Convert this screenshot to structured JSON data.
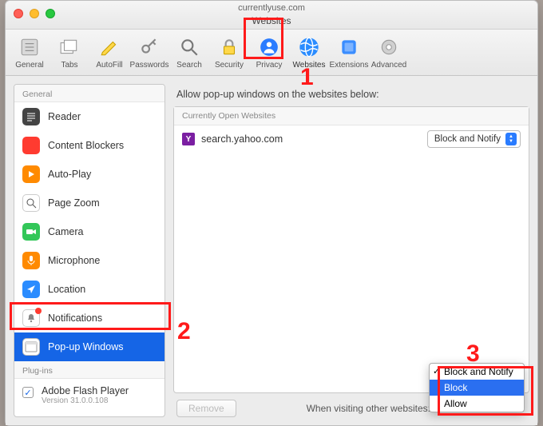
{
  "window": {
    "url": "currentlyuse.com",
    "title": "Websites"
  },
  "toolbar": [
    {
      "id": "general",
      "label": "General"
    },
    {
      "id": "tabs",
      "label": "Tabs"
    },
    {
      "id": "autofill",
      "label": "AutoFill"
    },
    {
      "id": "passwords",
      "label": "Passwords"
    },
    {
      "id": "search",
      "label": "Search"
    },
    {
      "id": "security",
      "label": "Security"
    },
    {
      "id": "privacy",
      "label": "Privacy"
    },
    {
      "id": "websites",
      "label": "Websites",
      "selected": true
    },
    {
      "id": "extensions",
      "label": "Extensions"
    },
    {
      "id": "advanced",
      "label": "Advanced"
    }
  ],
  "sidebar": {
    "section_general": "General",
    "items": [
      {
        "id": "reader",
        "label": "Reader"
      },
      {
        "id": "content-blockers",
        "label": "Content Blockers"
      },
      {
        "id": "auto-play",
        "label": "Auto-Play"
      },
      {
        "id": "page-zoom",
        "label": "Page Zoom"
      },
      {
        "id": "camera",
        "label": "Camera"
      },
      {
        "id": "microphone",
        "label": "Microphone"
      },
      {
        "id": "location",
        "label": "Location"
      },
      {
        "id": "notifications",
        "label": "Notifications",
        "badge": true
      },
      {
        "id": "popup-windows",
        "label": "Pop-up Windows",
        "selected": true
      }
    ],
    "section_plugins": "Plug-ins",
    "plugins": [
      {
        "name": "Adobe Flash Player",
        "version": "Version 31.0.0.108",
        "checked": true
      }
    ]
  },
  "main": {
    "heading": "Allow pop-up windows on the websites below:",
    "table_header": "Currently Open Websites",
    "rows": [
      {
        "favicon_letter": "Y",
        "site": "search.yahoo.com",
        "policy": "Block and Notify"
      }
    ],
    "remove_label": "Remove",
    "footer_label": "When visiting other websites:",
    "dropdown": {
      "options": [
        "Block and Notify",
        "Block",
        "Allow"
      ],
      "checked": "Block and Notify",
      "highlighted": "Block"
    }
  },
  "annotations": {
    "n1": "1",
    "n2": "2",
    "n3": "3"
  }
}
